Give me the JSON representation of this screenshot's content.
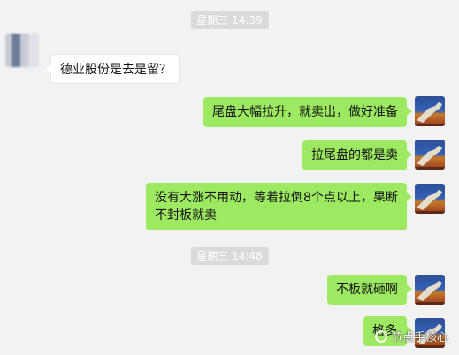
{
  "chat": {
    "timestamps": [
      "星期三 14:39",
      "星期三 14:48"
    ],
    "messages": [
      {
        "side": "left",
        "text": "德业股份是去是留？"
      },
      {
        "side": "right",
        "text": "尾盘大幅拉升，就卖出，做好准备"
      },
      {
        "side": "right",
        "text": "拉尾盘的都是卖"
      },
      {
        "side": "right",
        "text": "没有大涨不用动，等着拉倒8个点以上，果断不封板就卖"
      },
      {
        "side": "right",
        "text": "不板就砸啊"
      },
      {
        "side": "right",
        "text": "格多"
      }
    ]
  },
  "watermark": {
    "text": "节点手核心"
  },
  "colors": {
    "bubble_green": "#9ee962",
    "background": "#f2f2f2",
    "bubble_white": "#ffffff"
  }
}
